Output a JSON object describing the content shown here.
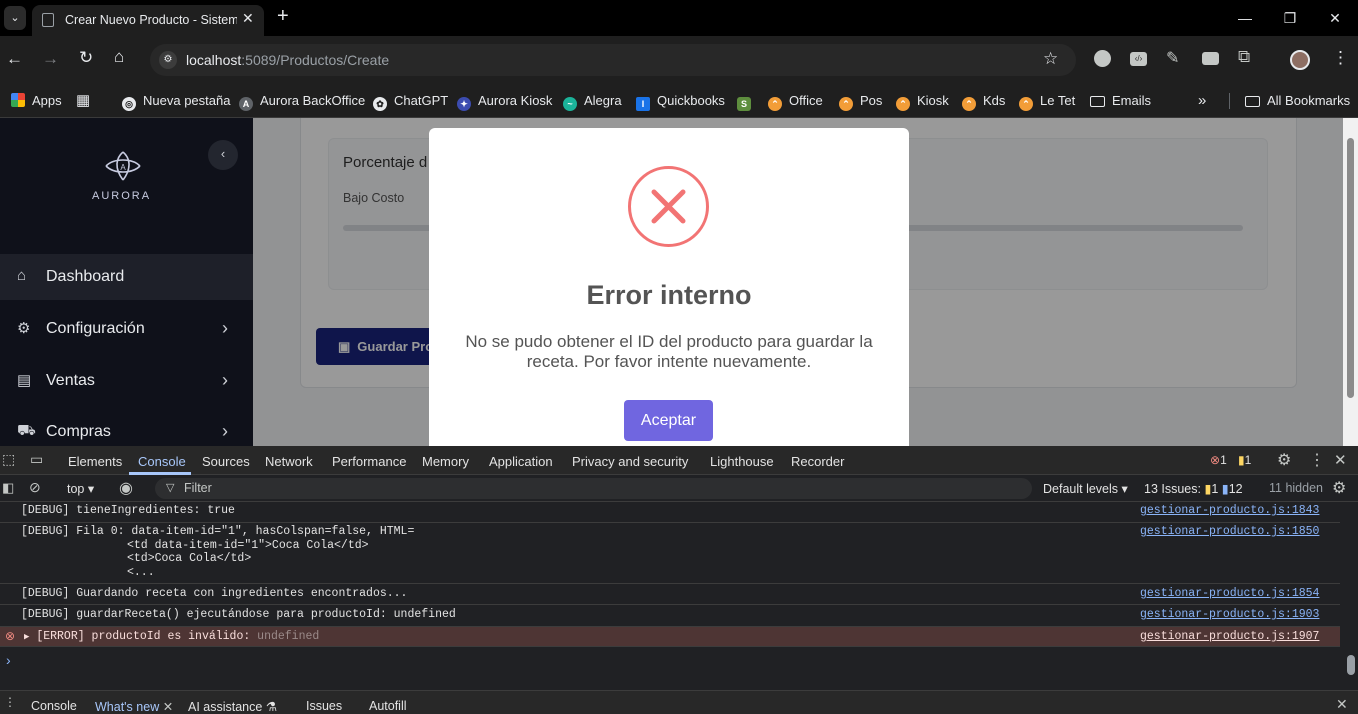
{
  "browser": {
    "tab_title": "Crear Nuevo Producto - Sistema",
    "url_host": "localhost",
    "url_path": ":5089/Productos/Create",
    "bookmarks": [
      {
        "label": "Apps",
        "icon": "apps-grid-icon"
      },
      {
        "label": "Nueva pestaña",
        "icon": "globe-icon"
      },
      {
        "label": "Aurora BackOffice",
        "icon": "aurora-icon"
      },
      {
        "label": "ChatGPT",
        "icon": "chatgpt-icon"
      },
      {
        "label": "Aurora Kiosk",
        "icon": "aurora-kiosk-icon"
      },
      {
        "label": "Alegra",
        "icon": "alegra-icon"
      },
      {
        "label": "Quickbooks",
        "icon": "quickbooks-icon"
      },
      {
        "label": "",
        "icon": "shopify-icon"
      },
      {
        "label": "Office",
        "icon": "office-icon"
      },
      {
        "label": "Pos",
        "icon": "pos-icon"
      },
      {
        "label": "Kiosk",
        "icon": "kiosk-icon"
      },
      {
        "label": "Kds",
        "icon": "kds-icon"
      },
      {
        "label": "Le Tet",
        "icon": "letet-icon"
      },
      {
        "label": "Emails",
        "icon": "folder-icon"
      }
    ],
    "all_bookmarks": "All Bookmarks"
  },
  "app": {
    "brand": "AURORA",
    "nav": [
      {
        "label": "Dashboard",
        "icon": "home-icon",
        "active": true
      },
      {
        "label": "Configuración",
        "icon": "cogs-icon"
      },
      {
        "label": "Ventas",
        "icon": "receipt-icon"
      },
      {
        "label": "Compras",
        "icon": "cart-icon"
      }
    ],
    "card_title": "Porcentaje d",
    "card_field": "Bajo Costo",
    "save_button": "Guardar Pro"
  },
  "modal": {
    "title": "Error interno",
    "message": "No se pudo obtener el ID del producto para guardar la receta. Por favor intente nuevamente.",
    "accept": "Aceptar",
    "accent": "#7066e0",
    "error_color": "#f27474"
  },
  "devtools": {
    "tabs": [
      "Elements",
      "Console",
      "Sources",
      "Network",
      "Performance",
      "Memory",
      "Application",
      "Privacy and security",
      "Lighthouse",
      "Recorder"
    ],
    "active_tab": "Console",
    "error_count": "1",
    "warn_count": "1",
    "context": "top",
    "filter_placeholder": "Filter",
    "levels": "Default levels",
    "issues_label": "13 Issues:",
    "issues_warn": "1",
    "issues_info": "12",
    "hidden": "11 hidden",
    "logs": [
      {
        "text": "[DEBUG] tieneIngredientes: true",
        "src": "gestionar-producto.js:1843"
      },
      {
        "text": "[DEBUG] Fila 0: data-item-id=\"1\", hasColspan=false, HTML=",
        "extra": [
          "<td data-item-id=\"1\">Coca Cola</td>",
          "<td>Coca Cola</td>",
          "<..."
        ],
        "src": "gestionar-producto.js:1850"
      },
      {
        "text": "[DEBUG] Guardando receta con ingredientes encontrados...",
        "src": "gestionar-producto.js:1854"
      },
      {
        "text": "[DEBUG] guardarReceta() ejecutándose para productoId: undefined",
        "src": "gestionar-producto.js:1903"
      },
      {
        "text": "[ERROR] productoId es inválido:",
        "value": "undefined",
        "src": "gestionar-producto.js:1907"
      }
    ],
    "prompt": "›",
    "drawer_tabs": [
      "Console",
      "What's new",
      "AI assistance",
      "Issues",
      "Autofill"
    ]
  }
}
